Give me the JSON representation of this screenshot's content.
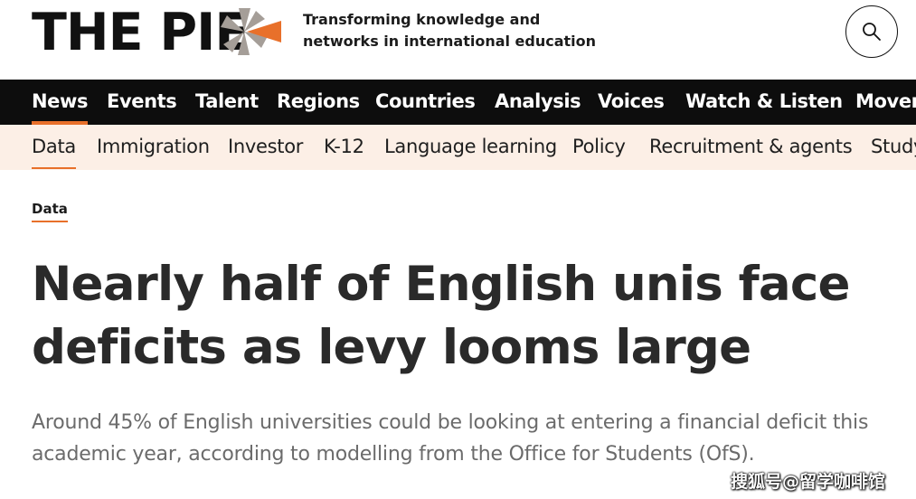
{
  "header": {
    "logo_text": "THE PIE",
    "tagline_line1": "Transforming knowledge and",
    "tagline_line2": "networks in international education",
    "search_icon": "search-icon"
  },
  "nav_main": {
    "items": [
      {
        "label": "News",
        "active": true
      },
      {
        "label": "Events"
      },
      {
        "label": "Talent"
      },
      {
        "label": "Regions"
      },
      {
        "label": "Countries"
      },
      {
        "label": "Analysis"
      },
      {
        "label": "Voices"
      },
      {
        "label": "Watch & Listen"
      },
      {
        "label": "Movers"
      }
    ]
  },
  "nav_sub": {
    "items": [
      {
        "label": "Data",
        "active": true
      },
      {
        "label": "Immigration"
      },
      {
        "label": "Investor"
      },
      {
        "label": "K-12"
      },
      {
        "label": "Language learning"
      },
      {
        "label": "Policy"
      },
      {
        "label": "Recruitment & agents"
      },
      {
        "label": "Study"
      }
    ]
  },
  "article": {
    "category": "Data",
    "headline": "Nearly half of English unis face deficits as levy looms large",
    "standfirst": "Around 45% of English universities could be looking at entering a financial deficit this academic year, according to modelling from the Office for Students (OfS)."
  },
  "watermark": "搜狐号@留学咖啡馆",
  "colors": {
    "accent": "#e8702a",
    "nav_bg": "#0d0d0d",
    "subnav_bg": "#fcefe6",
    "logo_grey": "#a59e98"
  }
}
